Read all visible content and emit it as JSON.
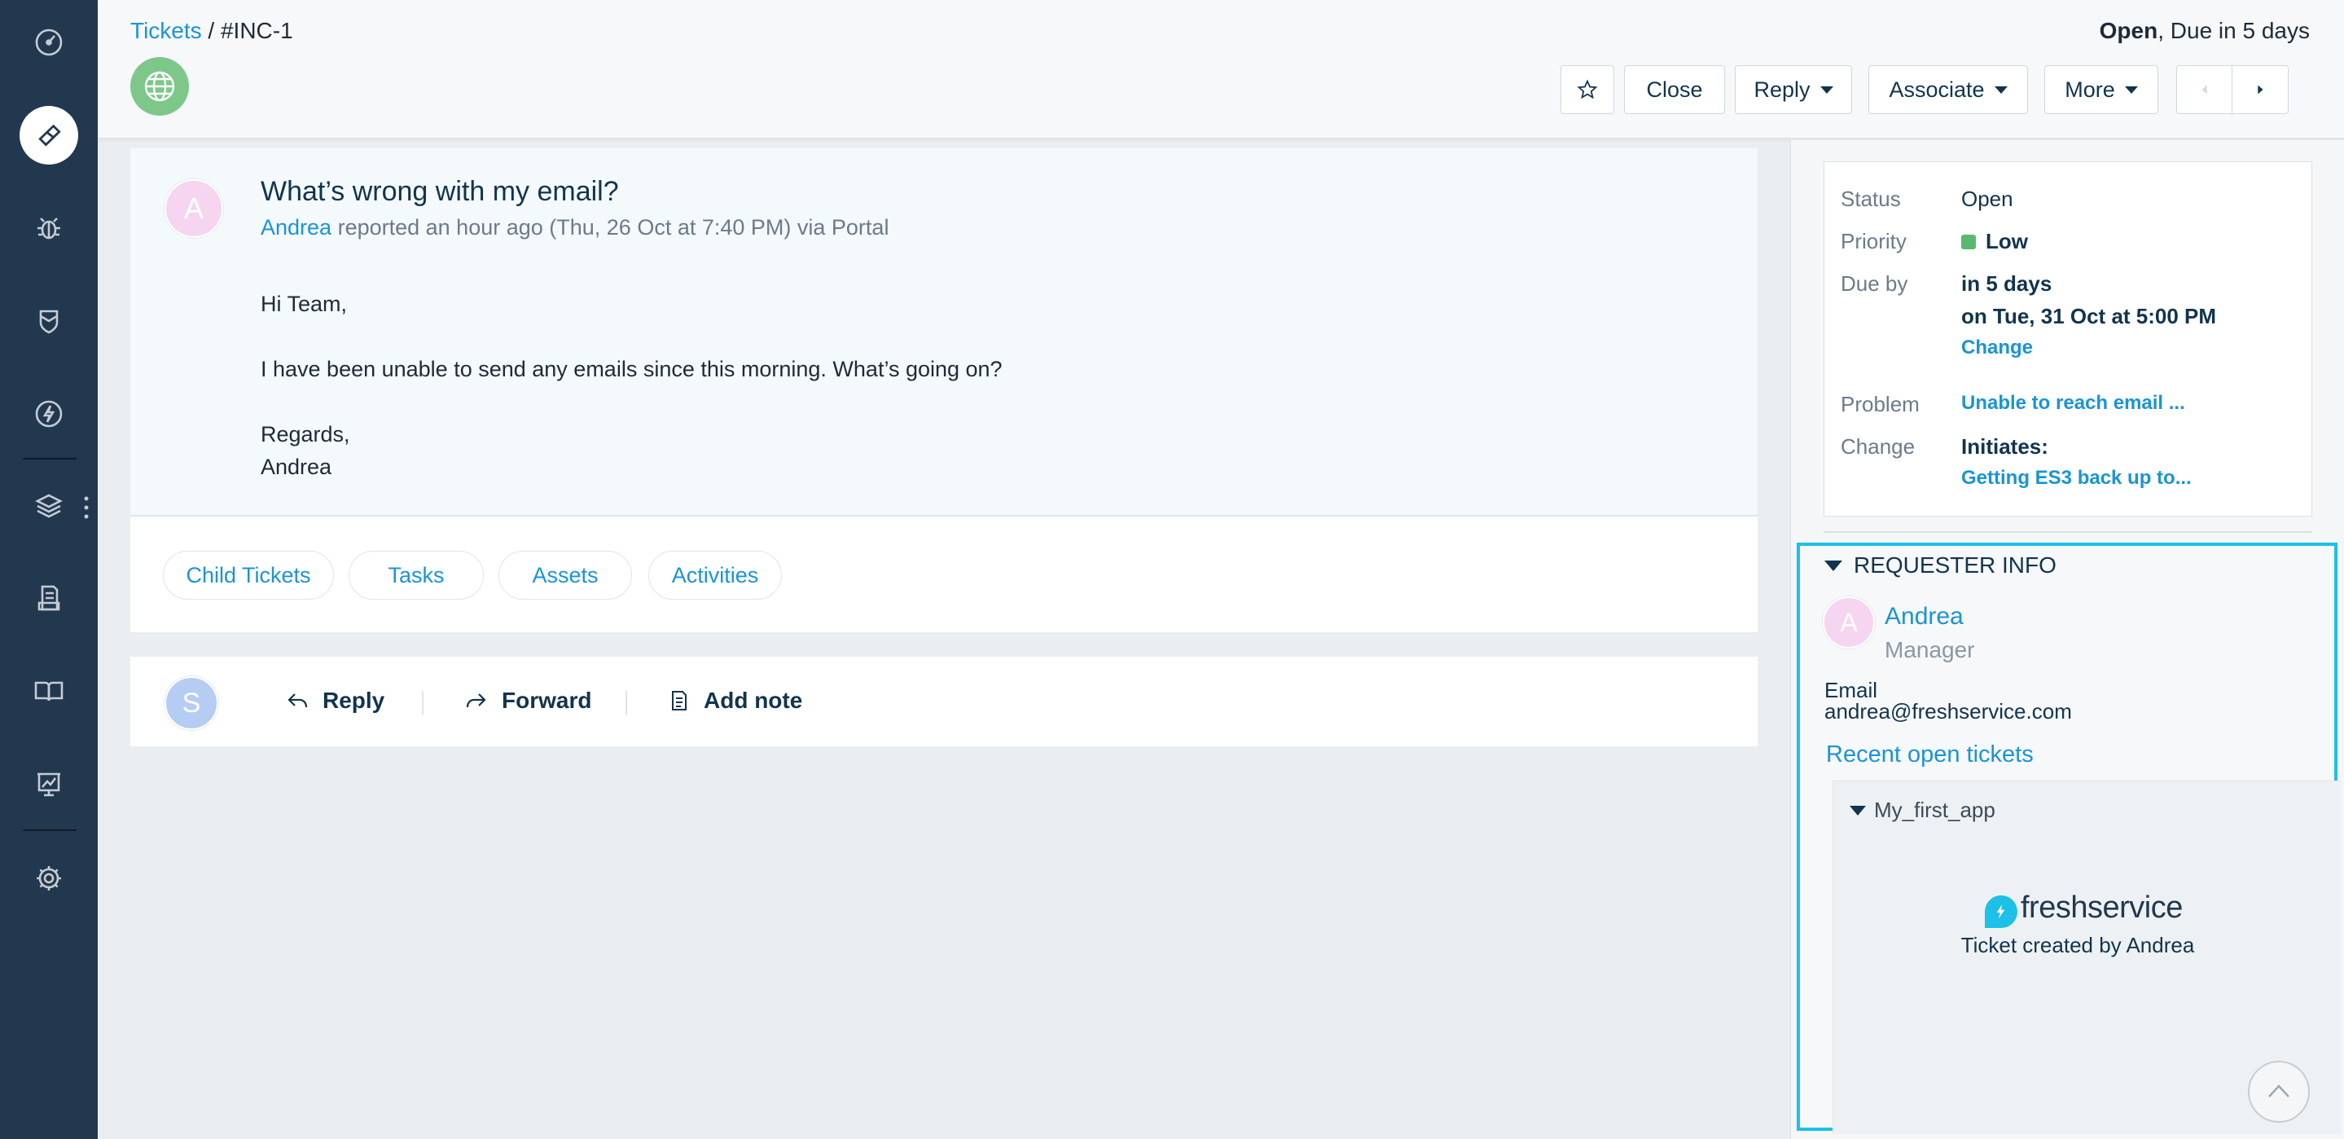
{
  "breadcrumb": {
    "tickets": "Tickets",
    "separator": " / ",
    "ticket_id": "#INC-1"
  },
  "header_status": {
    "state": "Open",
    "due": ", Due in 5 days"
  },
  "toolbar": {
    "star_icon": "star-icon",
    "close_label": "Close",
    "reply_label": "Reply",
    "associate_label": "Associate",
    "more_label": "More"
  },
  "nav": {
    "items": [
      "dashboard-icon",
      "tickets-icon",
      "problems-icon",
      "changes-icon",
      "releases-icon",
      "assets-icon",
      "contracts-icon",
      "solutions-icon",
      "reports-icon",
      "settings-icon"
    ],
    "active": "tickets-icon"
  },
  "ticket": {
    "avatar_initial": "A",
    "subject": "What’s wrong with my email?",
    "requester": "Andrea",
    "meta": " reported an hour ago (Thu, 26 Oct at 7:40 PM) via Portal",
    "body": [
      "Hi Team,",
      "I have been unable to send any emails since this morning. What’s going on?",
      "Regards,",
      "Andrea"
    ]
  },
  "tabs": [
    "Child Tickets",
    "Tasks",
    "Assets",
    "Activities"
  ],
  "actions": {
    "agent_initial": "S",
    "reply": "Reply",
    "forward": "Forward",
    "add_note": "Add note"
  },
  "properties": {
    "status_label": "Status",
    "status_value": "Open",
    "priority_label": "Priority",
    "priority_value": "Low",
    "due_label": "Due by",
    "due_value": "in 5 days",
    "due_date": "on Tue, 31 Oct at 5:00 PM",
    "due_change": "Change",
    "problem_label": "Problem",
    "problem_value": "Unable to reach email ...",
    "change_label": "Change",
    "change_value_label": "Initiates:",
    "change_value": "Getting ES3 back up to..."
  },
  "requester_info": {
    "title": "REQUESTER INFO",
    "avatar_initial": "A",
    "name": "Andrea",
    "role": "Manager",
    "email_label": "Email",
    "email": "andrea@freshservice.com",
    "recent_link": "Recent open tickets",
    "app_name": "My_first_app",
    "brand": "freshservice",
    "caption": "Ticket created by Andrea"
  },
  "colors": {
    "accent": "#1a94d5",
    "nav": "#22384f",
    "highlight": "#1cc0e8",
    "priority_low": "#5cb86e"
  }
}
